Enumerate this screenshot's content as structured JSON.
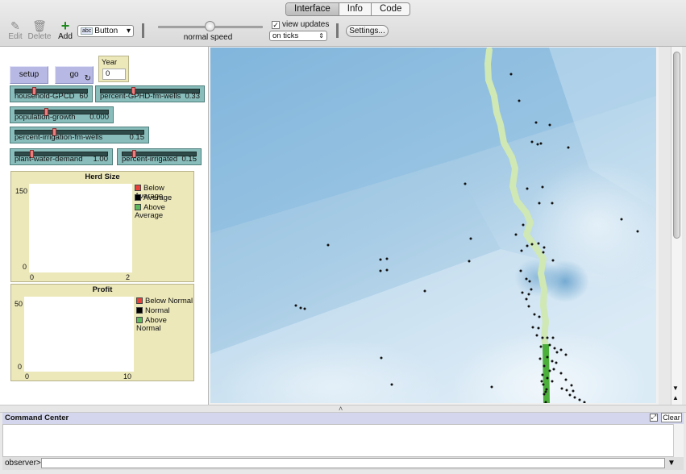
{
  "tabs": [
    "Interface",
    "Info",
    "Code"
  ],
  "toolbar": {
    "edit_label": "Edit",
    "delete_label": "Delete",
    "add_label": "Add",
    "widget_type": "Button",
    "speed_label": "normal speed",
    "view_updates_label": "view updates",
    "view_updates_checked": true,
    "update_mode": "on ticks",
    "settings_label": "Settings..."
  },
  "widgets": {
    "setup_label": "setup",
    "go_label": "go",
    "year": {
      "label": "Year",
      "value": "0"
    },
    "sliders": [
      {
        "id": "household-gpcd",
        "label": "household-GPCD",
        "value": "60",
        "level": 0.25
      },
      {
        "id": "percent-gphd-fm-wells",
        "label": "percent-GPHD-fm-wells",
        "value": "0.33",
        "level": 0.33
      },
      {
        "id": "population-growth",
        "label": "population-growth",
        "value": "0.000",
        "level": 0.33
      },
      {
        "id": "percent-irrigation-fm-wells",
        "label": "percent-irrigation-fm-wells",
        "value": "0.15",
        "level": 0.3
      },
      {
        "id": "plant-water-demand",
        "label": "plant-water-demand",
        "value": "1.00",
        "level": 0.17
      },
      {
        "id": "percent-irrigated",
        "label": "percent-irrigated",
        "value": "0.15",
        "level": 0.15
      }
    ],
    "herd_plot": {
      "title": "Herd Size",
      "y_max": "150",
      "y_min": "0",
      "x_min": "0",
      "x_max": "2",
      "legend": [
        {
          "label": "Below Average",
          "color": "#e8413b"
        },
        {
          "label": "Average",
          "color": "#000000"
        },
        {
          "label": "Above Average",
          "color": "#5cb85c"
        }
      ]
    },
    "profit_plot": {
      "title": "Profit",
      "y_max": "50",
      "y_min": "0",
      "x_min": "0",
      "x_max": "10",
      "legend": [
        {
          "label": "Below Normal",
          "color": "#e8413b"
        },
        {
          "label": "Normal",
          "color": "#000000"
        },
        {
          "label": "Above Normal",
          "color": "#5cb85c"
        }
      ]
    }
  },
  "command_center": {
    "title": "Command Center",
    "clear_label": "Clear",
    "prompt": "observer>"
  },
  "colors": {
    "river": "#cfe8b4",
    "river_green": "#4caf3c",
    "agents": "#111111"
  }
}
